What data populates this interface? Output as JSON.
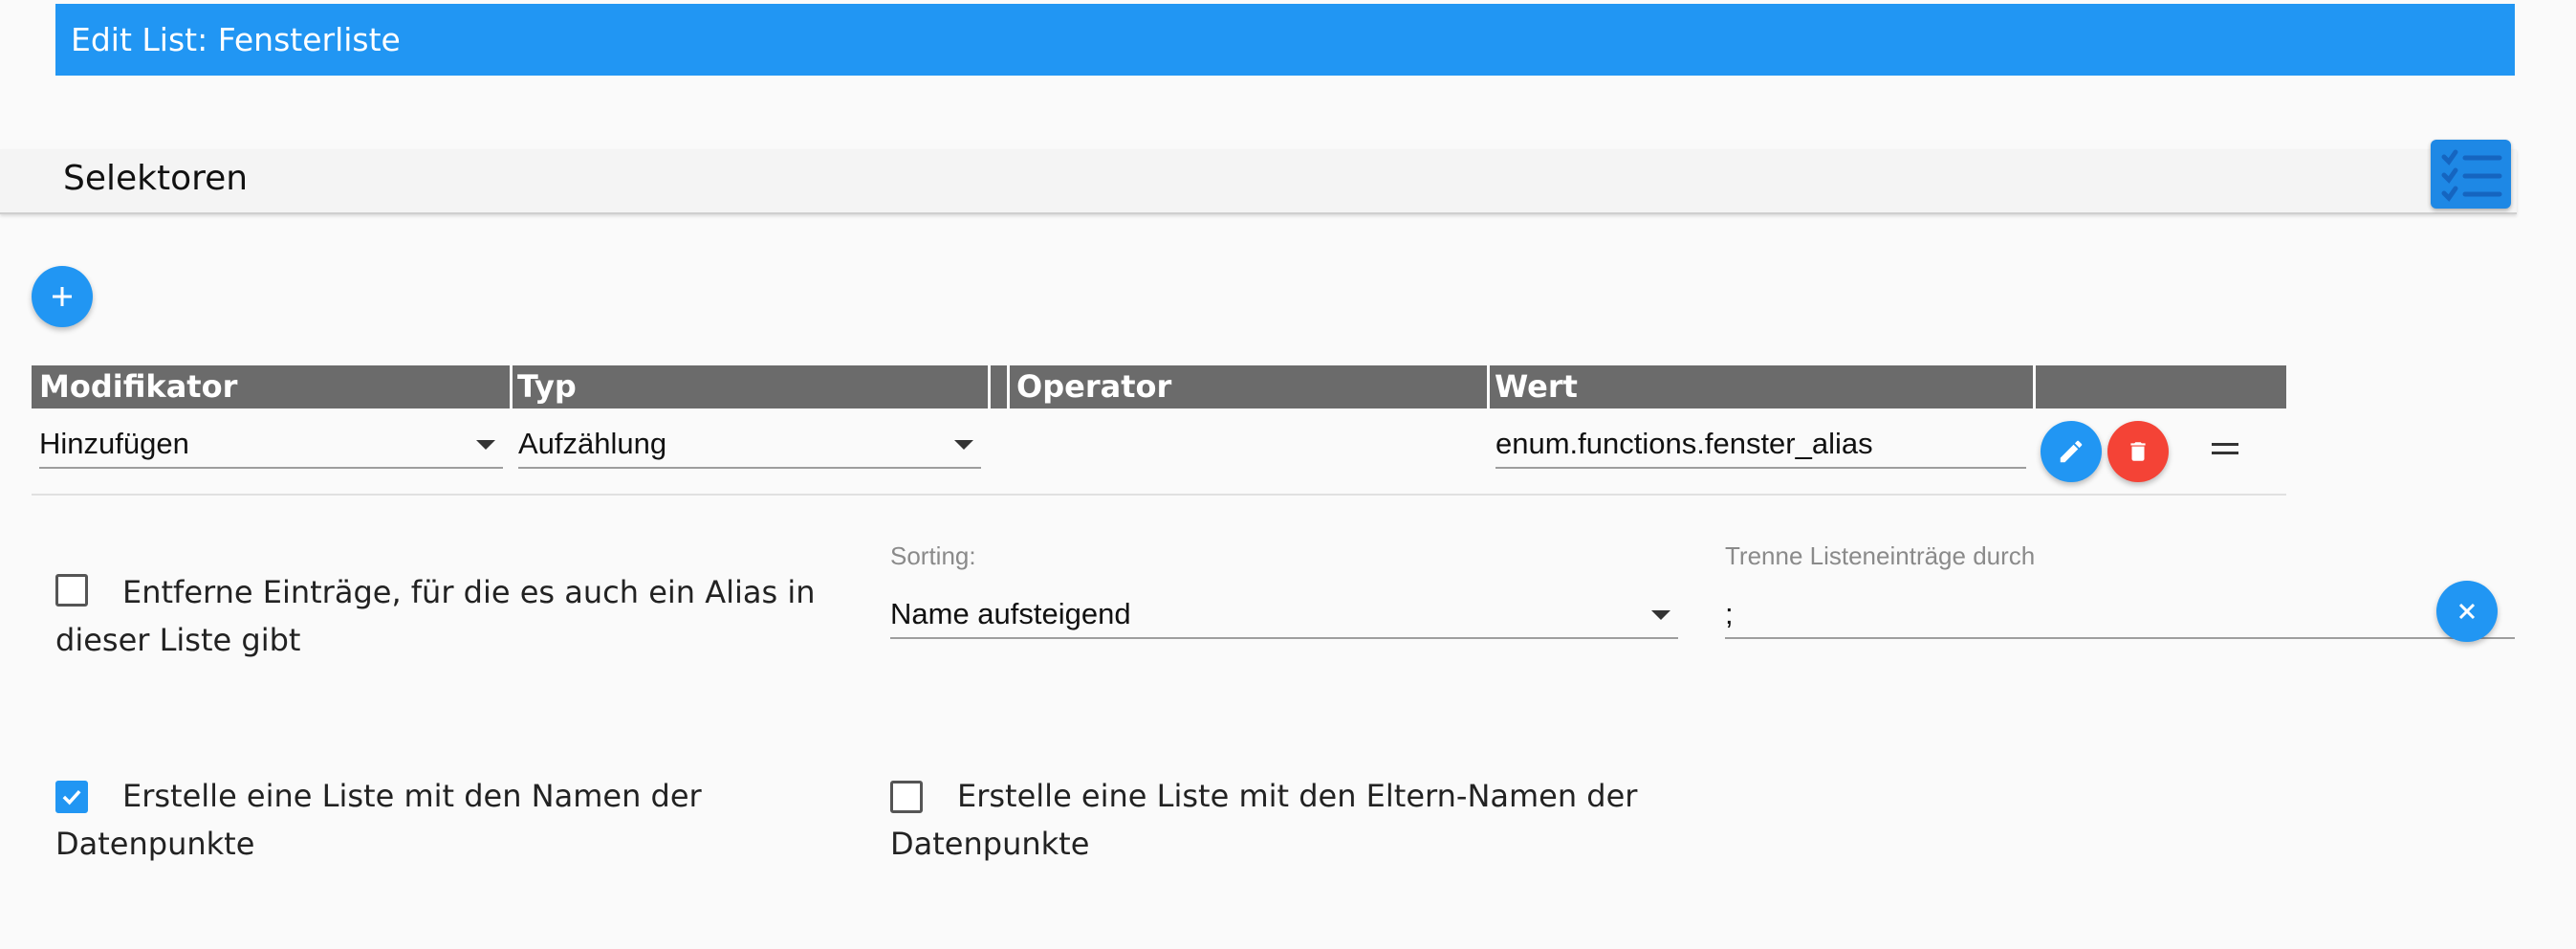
{
  "title": "Edit List: Fensterliste",
  "section": {
    "title": "Selektoren",
    "list_icon": "checklist-icon"
  },
  "add_icon": "plus-icon",
  "colors": {
    "primary": "#2196f3",
    "danger": "#f44336",
    "header_bg": "#6b6b6b"
  },
  "table": {
    "headers": [
      "Modifikator",
      "Typ",
      "Operator",
      "Wert"
    ],
    "rows": [
      {
        "modifier": "Hinzufügen",
        "type": "Aufzählung",
        "operator": "",
        "value": "enum.functions.fenster_alias"
      }
    ]
  },
  "options": {
    "remove_alias": {
      "label_line1": "Entferne Einträge, für die es auch ein Alias in",
      "label_line2": "dieser Liste gibt",
      "checked": false
    },
    "sorting": {
      "label": "Sorting:",
      "value": "Name aufsteigend"
    },
    "separator": {
      "label": "Trenne Listeneinträge durch",
      "value": ";"
    },
    "names_list": {
      "label_line1": "Erstelle eine Liste mit den Namen der",
      "label_line2": "Datenpunkte",
      "checked": true
    },
    "parent_names_list": {
      "label_line1": "Erstelle eine Liste mit den Eltern-Namen der",
      "label_line2": "Datenpunkte",
      "checked": false
    }
  }
}
